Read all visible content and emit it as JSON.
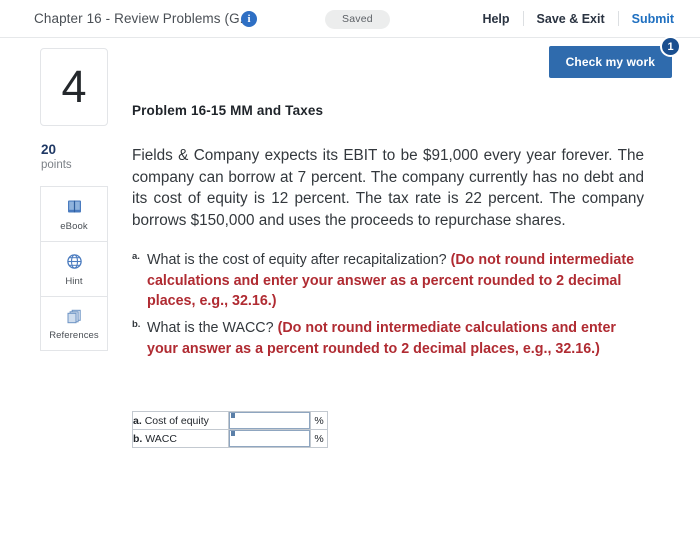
{
  "topbar": {
    "title": "Chapter 16 - Review Problems (G...",
    "info_icon": "info-icon",
    "saved_label": "Saved",
    "help_label": "Help",
    "save_exit_label": "Save & Exit",
    "submit_label": "Submit"
  },
  "check_my_work": {
    "label": "Check my work",
    "badge_count": "1"
  },
  "rail": {
    "question_number": "4",
    "points_value": "20",
    "points_label": "points",
    "tools": [
      {
        "label": "eBook",
        "icon": "book-icon"
      },
      {
        "label": "Hint",
        "icon": "globe-icon"
      },
      {
        "label": "References",
        "icon": "documents-stack-icon"
      }
    ]
  },
  "problem": {
    "title": "Problem 16-15 MM and Taxes",
    "stem": "Fields & Company expects its EBIT to be $91,000 every year forever. The company can borrow at 7 percent. The company currently has no debt and its cost of equity is 12 percent. The tax rate is 22 percent. The company borrows $150,000 and uses the proceeds to repurchase shares.",
    "questions": [
      {
        "label": "a.",
        "text": "What is the cost of equity after recapitalization? ",
        "hint": "(Do not round intermediate calculations and enter your answer as a percent rounded to 2 decimal places, e.g., 32.16.)"
      },
      {
        "label": "b.",
        "text": "What is the WACC? ",
        "hint": "(Do not round intermediate calculations and enter your answer as a percent rounded to 2 decimal places, e.g., 32.16.)"
      }
    ]
  },
  "answer_table": {
    "rows": [
      {
        "marker": "a.",
        "label": "Cost of equity",
        "value": "",
        "unit": "%"
      },
      {
        "marker": "b.",
        "label": "WACC",
        "value": "",
        "unit": "%"
      }
    ]
  },
  "colors": {
    "accent_blue": "#2f6bad",
    "badge_blue": "#1b4f8f",
    "link_blue": "#1e6fc0",
    "hint_red": "#b02b32",
    "points_navy": "#1f3864"
  }
}
